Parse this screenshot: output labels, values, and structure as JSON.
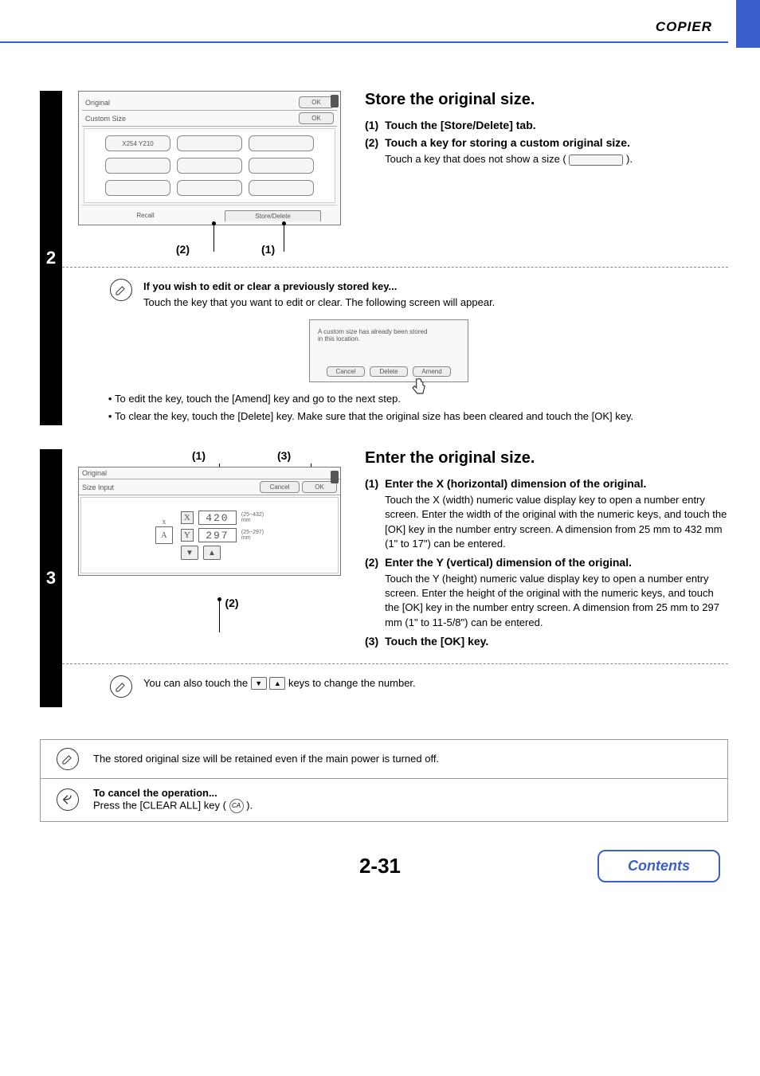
{
  "header": {
    "section": "COPIER"
  },
  "step2": {
    "number": "2",
    "panel": {
      "title": "Original",
      "subtitle": "Custom Size",
      "ok": "OK",
      "stored_key": "X254 Y210",
      "tabs": {
        "recall": "Recall",
        "store": "Store/Delete"
      }
    },
    "callouts": {
      "c1": "(1)",
      "c2": "(2)"
    },
    "title": "Store the original size.",
    "items": [
      {
        "num": "(1)",
        "txt": "Touch the [Store/Delete] tab."
      },
      {
        "num": "(2)",
        "txt": "Touch a key for storing a custom original size.",
        "sub_prefix": "Touch a key that does not show a size (",
        "sub_suffix": ")."
      }
    ],
    "note": {
      "bold": "If you wish to edit or clear a previously stored key...",
      "body": "Touch the key that you want to edit or clear. The following screen will appear."
    },
    "dialog": {
      "line1": "A custom size has already been stored",
      "line2": "in this location.",
      "cancel": "Cancel",
      "delete": "Delete",
      "amend": "Amend"
    },
    "bullets": [
      "To edit the key, touch the [Amend] key and go to the next step.",
      "To clear the key, touch the [Delete] key. Make sure that the original size has been cleared and touch the [OK] key."
    ]
  },
  "step3": {
    "number": "3",
    "panel": {
      "title": "Original",
      "subtitle": "Size Input",
      "cancel": "Cancel",
      "ok": "OK",
      "x_label": "X",
      "x_val": "420",
      "x_range": "(25~432)\nmm",
      "y_label": "Y",
      "y_val": "297",
      "y_range": "(25~297)\nmm",
      "orig_mark": "A"
    },
    "callouts": {
      "c1": "(1)",
      "c2": "(2)",
      "c3": "(3)"
    },
    "title": "Enter the original size.",
    "items": [
      {
        "num": "(1)",
        "txt": "Enter the X (horizontal) dimension of the original.",
        "sub": "Touch the X (width) numeric value display key to open a number entry screen. Enter the width of the original with the numeric keys, and touch the [OK] key in the number entry screen. A dimension from 25 mm to 432 mm (1\" to 17\") can be entered."
      },
      {
        "num": "(2)",
        "txt": "Enter the Y (vertical) dimension of the original.",
        "sub": "Touch the Y (height) numeric value display key to open a number entry screen. Enter the height of the original with the numeric keys, and touch the [OK] key in the number entry screen. A dimension from 25 mm to 297 mm (1\" to 11-5/8\") can be entered."
      },
      {
        "num": "(3)",
        "txt": "Touch the [OK] key."
      }
    ],
    "note_prefix": "You can also touch the ",
    "note_suffix": " keys to change the number."
  },
  "boxnotes": {
    "retain": "The stored original size will be retained even if the main power is turned off.",
    "cancel_title": "To cancel the operation...",
    "cancel_body_a": "Press the [CLEAR ALL] key (",
    "cancel_body_b": ").",
    "ca": "CA"
  },
  "footer": {
    "page": "2-31",
    "contents": "Contents"
  }
}
